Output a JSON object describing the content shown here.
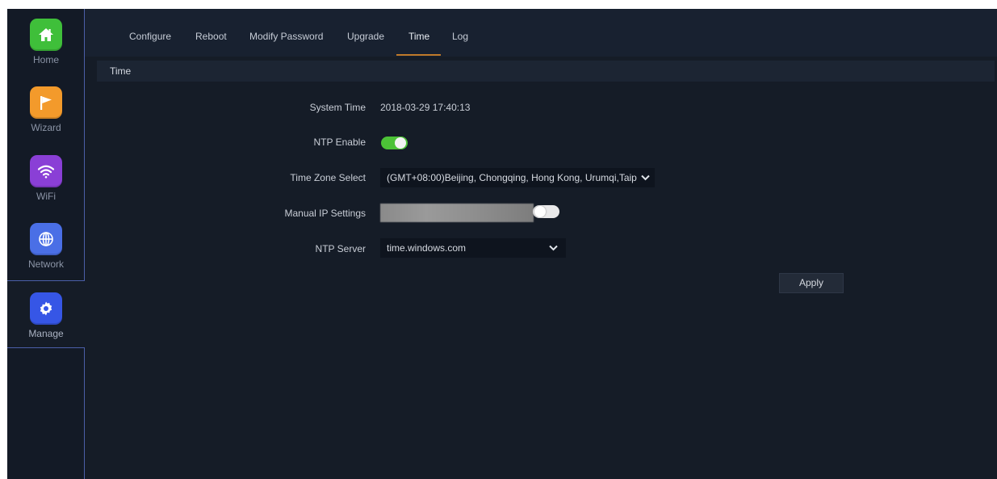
{
  "sidebar": {
    "items": [
      {
        "label": "Home",
        "icon": "home-icon",
        "color": "#3fbf3a"
      },
      {
        "label": "Wizard",
        "icon": "flag-icon",
        "color": "#f39a2b"
      },
      {
        "label": "WiFi",
        "icon": "wifi-icon",
        "color": "#8a3fd6"
      },
      {
        "label": "Network",
        "icon": "globe-icon",
        "color": "#4a6fe6"
      },
      {
        "label": "Manage",
        "icon": "gear-icon",
        "color": "#3656e6"
      }
    ],
    "active": "Manage"
  },
  "tabs": {
    "items": [
      "Configure",
      "Reboot",
      "Modify Password",
      "Upgrade",
      "Time",
      "Log"
    ],
    "active": "Time"
  },
  "section": {
    "title": "Time"
  },
  "form": {
    "system_time_label": "System Time",
    "system_time_value": "2018-03-29 17:40:13",
    "ntp_enable_label": "NTP Enable",
    "ntp_enable_value": true,
    "timezone_label": "Time Zone Select",
    "timezone_value": "(GMT+08:00)Beijing, Chongqing, Hong Kong, Urumqi,Taip",
    "manual_ip_label": "Manual IP Settings",
    "manual_ip_toggle": false,
    "ntp_server_label": "NTP Server",
    "ntp_server_value": "time.windows.com",
    "apply_label": "Apply"
  },
  "colors": {
    "accent_tab": "#c07a2a",
    "toggle_on": "#4cc237"
  }
}
